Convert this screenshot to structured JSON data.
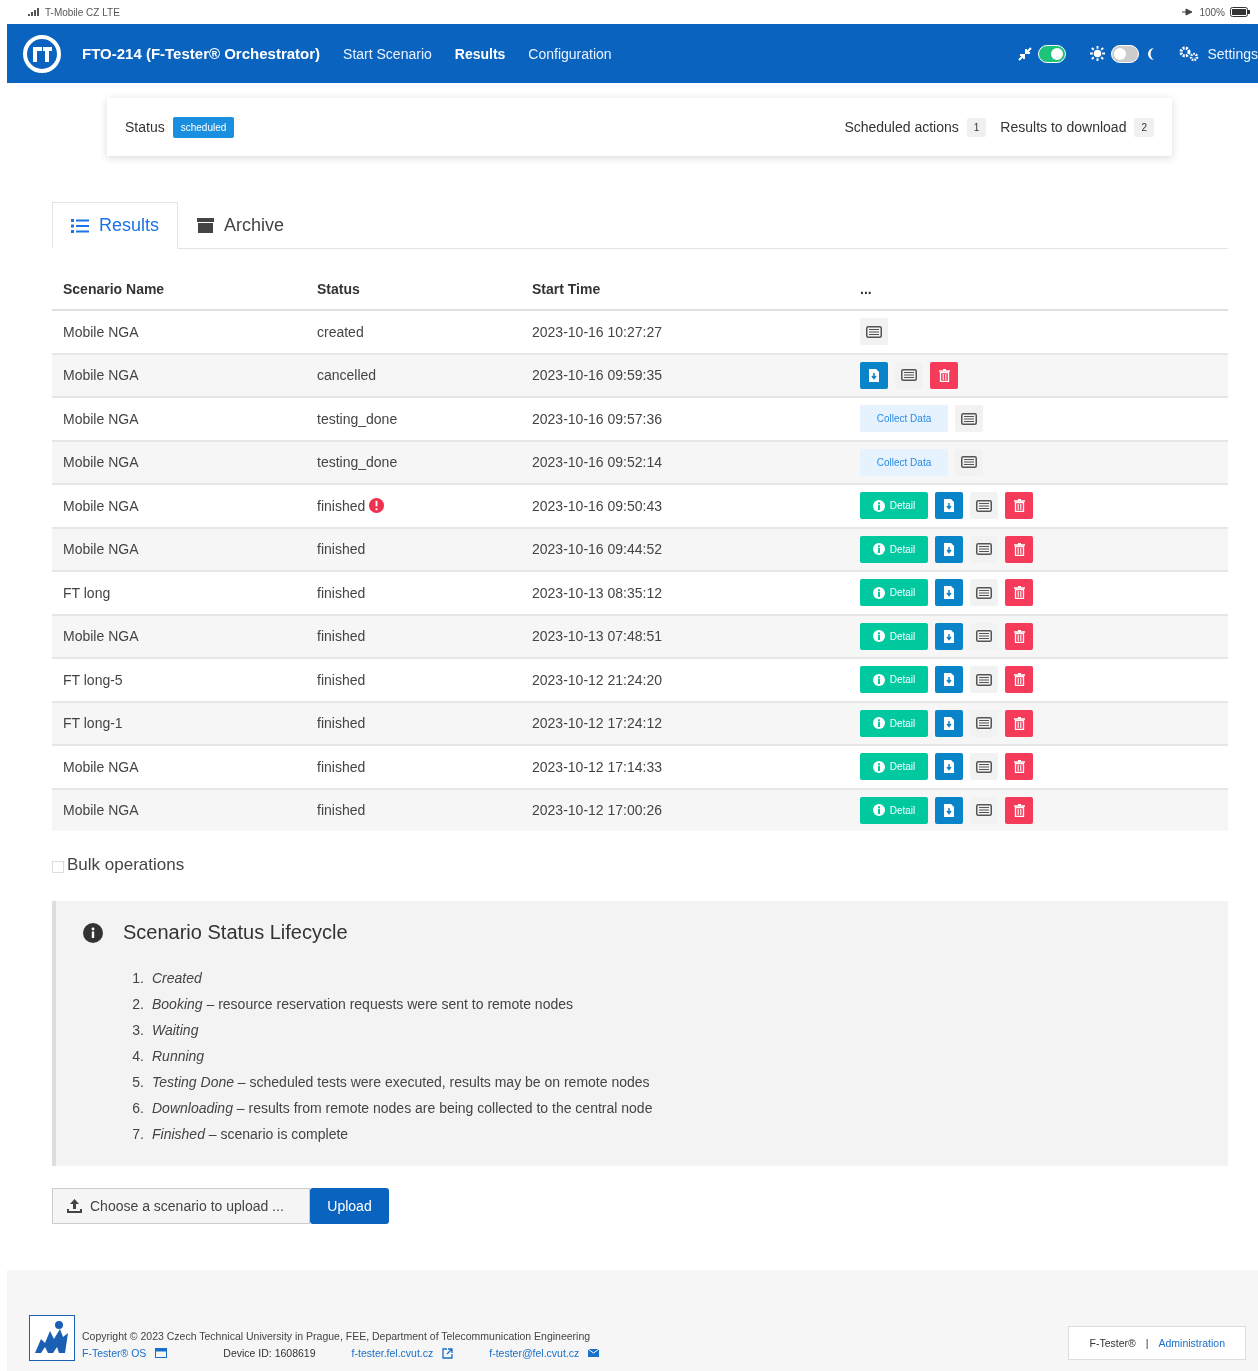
{
  "phone_status": {
    "carrier": "T-Mobile CZ LTE",
    "battery": "100%"
  },
  "navbar": {
    "title": "FTO-214 (F-Tester® Orchestrator)",
    "items": [
      {
        "label": "Start Scenario",
        "selected": false
      },
      {
        "label": "Results",
        "selected": true
      },
      {
        "label": "Configuration",
        "selected": false
      }
    ],
    "toggles": [
      {
        "kind": "compact",
        "on": true
      },
      {
        "kind": "theme",
        "on": false
      }
    ],
    "settings": "Settings"
  },
  "status_card": {
    "label": "Status",
    "status": "scheduled",
    "counters": [
      {
        "label": "Scheduled actions",
        "count": "1"
      },
      {
        "label": "Results to download",
        "count": "2"
      }
    ]
  },
  "tabs": [
    {
      "label": "Results",
      "kind": "list",
      "selected": true
    },
    {
      "label": "Archive",
      "kind": "archive",
      "selected": false
    }
  ],
  "table": {
    "columns": [
      "Scenario Name",
      "Status",
      "Start Time",
      "..."
    ],
    "rows": [
      {
        "name": "Mobile NGA",
        "status": "created",
        "alert": false,
        "start": "2023-10-16 10:27:27",
        "actions": [
          {
            "kind": "log"
          }
        ]
      },
      {
        "name": "Mobile NGA",
        "status": "cancelled",
        "alert": false,
        "start": "2023-10-16 09:59:35",
        "actions": [
          {
            "kind": "download"
          },
          {
            "kind": "log"
          },
          {
            "kind": "delete"
          }
        ]
      },
      {
        "name": "Mobile NGA",
        "status": "testing_done",
        "alert": false,
        "start": "2023-10-16 09:57:36",
        "actions": [
          {
            "kind": "collect",
            "label": "Collect Data"
          },
          {
            "kind": "log"
          }
        ]
      },
      {
        "name": "Mobile NGA",
        "status": "testing_done",
        "alert": false,
        "start": "2023-10-16 09:52:14",
        "actions": [
          {
            "kind": "collect",
            "label": "Collect Data"
          },
          {
            "kind": "log"
          }
        ]
      },
      {
        "name": "Mobile NGA",
        "status": "finished",
        "alert": true,
        "start": "2023-10-16 09:50:43",
        "actions": [
          {
            "kind": "detail",
            "label": "Detail"
          },
          {
            "kind": "download"
          },
          {
            "kind": "log"
          },
          {
            "kind": "delete"
          }
        ]
      },
      {
        "name": "Mobile NGA",
        "status": "finished",
        "alert": false,
        "start": "2023-10-16 09:44:52",
        "actions": [
          {
            "kind": "detail",
            "label": "Detail"
          },
          {
            "kind": "download"
          },
          {
            "kind": "log"
          },
          {
            "kind": "delete"
          }
        ]
      },
      {
        "name": "FT long",
        "status": "finished",
        "alert": false,
        "start": "2023-10-13 08:35:12",
        "actions": [
          {
            "kind": "detail",
            "label": "Detail"
          },
          {
            "kind": "download"
          },
          {
            "kind": "log"
          },
          {
            "kind": "delete"
          }
        ]
      },
      {
        "name": "Mobile NGA",
        "status": "finished",
        "alert": false,
        "start": "2023-10-13 07:48:51",
        "actions": [
          {
            "kind": "detail",
            "label": "Detail"
          },
          {
            "kind": "download"
          },
          {
            "kind": "log"
          },
          {
            "kind": "delete"
          }
        ]
      },
      {
        "name": "FT long-5",
        "status": "finished",
        "alert": false,
        "start": "2023-10-12 21:24:20",
        "actions": [
          {
            "kind": "detail",
            "label": "Detail"
          },
          {
            "kind": "download"
          },
          {
            "kind": "log"
          },
          {
            "kind": "delete"
          }
        ]
      },
      {
        "name": "FT long-1",
        "status": "finished",
        "alert": false,
        "start": "2023-10-12 17:24:12",
        "actions": [
          {
            "kind": "detail",
            "label": "Detail"
          },
          {
            "kind": "download"
          },
          {
            "kind": "log"
          },
          {
            "kind": "delete"
          }
        ]
      },
      {
        "name": "Mobile NGA",
        "status": "finished",
        "alert": false,
        "start": "2023-10-12 17:14:33",
        "actions": [
          {
            "kind": "detail",
            "label": "Detail"
          },
          {
            "kind": "download"
          },
          {
            "kind": "log"
          },
          {
            "kind": "delete"
          }
        ]
      },
      {
        "name": "Mobile NGA",
        "status": "finished",
        "alert": false,
        "start": "2023-10-12 17:00:26",
        "actions": [
          {
            "kind": "detail",
            "label": "Detail"
          },
          {
            "kind": "download"
          },
          {
            "kind": "log"
          },
          {
            "kind": "delete"
          }
        ]
      }
    ]
  },
  "bulk": {
    "label": "Bulk operations",
    "checked": false
  },
  "lifecycle": {
    "title": "Scenario Status Lifecycle",
    "items": [
      {
        "number": "1.",
        "text": "*Created*"
      },
      {
        "number": "2.",
        "text": "*Booking* – resource reservation requests were sent to remote nodes"
      },
      {
        "number": "3.",
        "text": "*Waiting*"
      },
      {
        "number": "4.",
        "text": "*Running*"
      },
      {
        "number": "5.",
        "text": "*Testing Done* – scheduled tests were executed, results may be on remote nodes"
      },
      {
        "number": "6.",
        "text": "*Downloading* – results from remote nodes are being collected to the central node"
      },
      {
        "number": "7.",
        "text": "*Finished* – scenario is complete"
      }
    ]
  },
  "upload": {
    "placeholder": "Choose a scenario to upload ...",
    "button": "Upload"
  },
  "footer": {
    "copyright": "Copyright © 2023 Czech Technical University in Prague, FEE, Department of Telecommunication Engineering",
    "os": "F-Tester® OS",
    "device": "Device ID: 1608619",
    "web": "f-tester.fel.cvut.cz",
    "email": "f-tester@fel.cvut.cz",
    "brand": "F-Tester®",
    "separator": "|",
    "admin": "Administration"
  }
}
